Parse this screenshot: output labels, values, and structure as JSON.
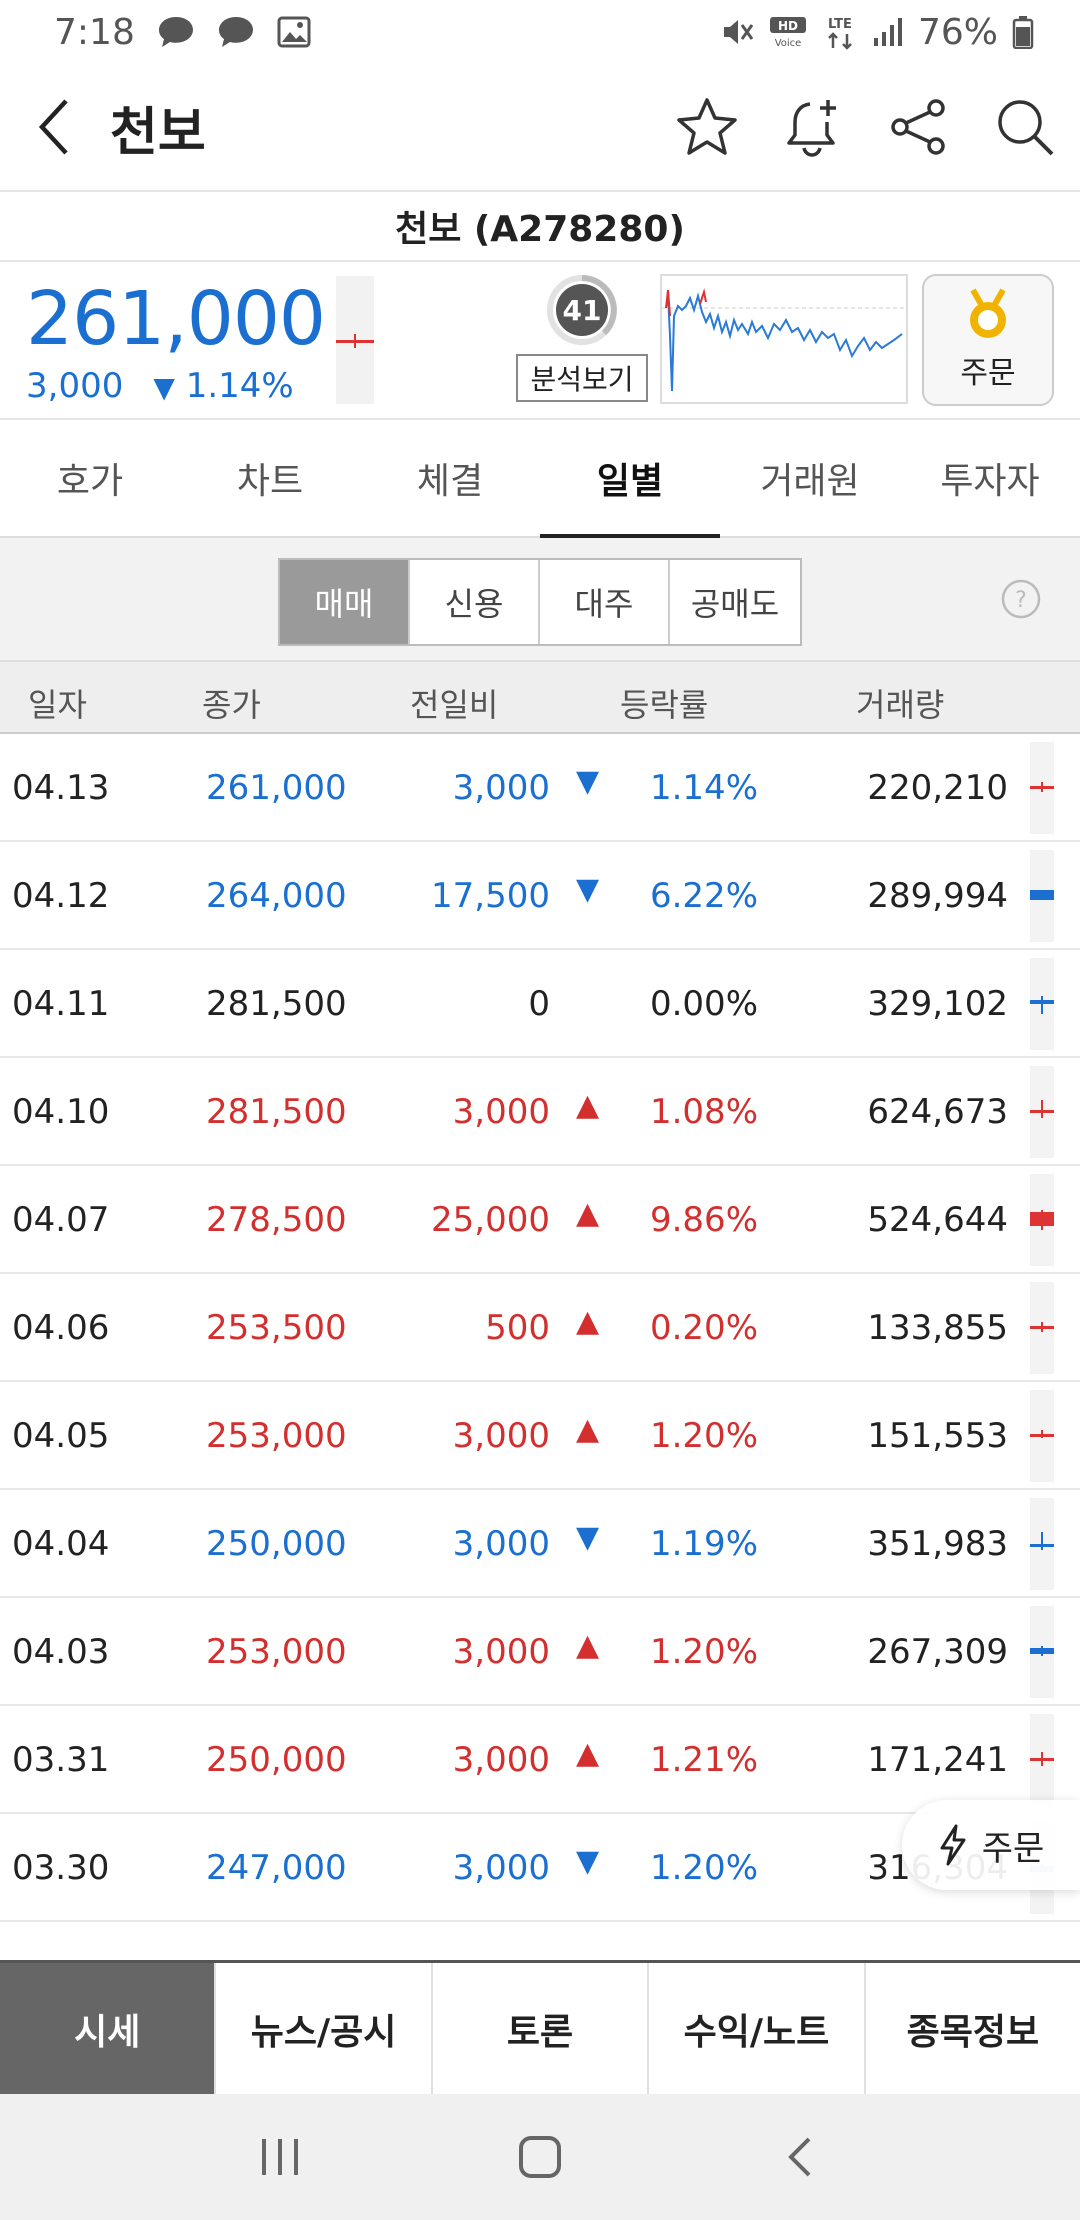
{
  "status_bar": {
    "time": "7:18",
    "battery": "76%"
  },
  "header": {
    "title": "천보"
  },
  "stock": {
    "name_code": "천보 (A278280)",
    "price": "261,000",
    "change": "3,000",
    "change_rate": "1.14%",
    "change_arrow": "▼",
    "score": "41",
    "analysis_label": "분석보기",
    "order_label": "주문",
    "colors": {
      "up": "#d32f2f",
      "down": "#1a6fd0"
    }
  },
  "tabs": [
    {
      "label": "호가"
    },
    {
      "label": "차트"
    },
    {
      "label": "체결"
    },
    {
      "label": "일별",
      "active": true
    },
    {
      "label": "거래원"
    },
    {
      "label": "투자자"
    }
  ],
  "filters": [
    {
      "label": "매매",
      "active": true
    },
    {
      "label": "신용"
    },
    {
      "label": "대주"
    },
    {
      "label": "공매도"
    }
  ],
  "table": {
    "headers": {
      "date": "일자",
      "close": "종가",
      "diff": "전일비",
      "rate": "등락률",
      "volume": "거래량"
    },
    "rows": [
      {
        "date": "04.13",
        "close": "261,000",
        "diff": "3,000",
        "arrow": "▼",
        "rate": "1.14%",
        "volume": "220,210",
        "dir": "down"
      },
      {
        "date": "04.12",
        "close": "264,000",
        "diff": "17,500",
        "arrow": "▼",
        "rate": "6.22%",
        "volume": "289,994",
        "dir": "down"
      },
      {
        "date": "04.11",
        "close": "281,500",
        "diff": "0",
        "arrow": "",
        "rate": "0.00%",
        "volume": "329,102",
        "dir": "flat"
      },
      {
        "date": "04.10",
        "close": "281,500",
        "diff": "3,000",
        "arrow": "▲",
        "rate": "1.08%",
        "volume": "624,673",
        "dir": "up"
      },
      {
        "date": "04.07",
        "close": "278,500",
        "diff": "25,000",
        "arrow": "▲",
        "rate": "9.86%",
        "volume": "524,644",
        "dir": "up"
      },
      {
        "date": "04.06",
        "close": "253,500",
        "diff": "500",
        "arrow": "▲",
        "rate": "0.20%",
        "volume": "133,855",
        "dir": "up"
      },
      {
        "date": "04.05",
        "close": "253,000",
        "diff": "3,000",
        "arrow": "▲",
        "rate": "1.20%",
        "volume": "151,553",
        "dir": "up"
      },
      {
        "date": "04.04",
        "close": "250,000",
        "diff": "3,000",
        "arrow": "▼",
        "rate": "1.19%",
        "volume": "351,983",
        "dir": "down"
      },
      {
        "date": "04.03",
        "close": "253,000",
        "diff": "3,000",
        "arrow": "▲",
        "rate": "1.20%",
        "volume": "267,309",
        "dir": "up"
      },
      {
        "date": "03.31",
        "close": "250,000",
        "diff": "3,000",
        "arrow": "▲",
        "rate": "1.21%",
        "volume": "171,241",
        "dir": "up"
      },
      {
        "date": "03.30",
        "close": "247,000",
        "diff": "3,000",
        "arrow": "▼",
        "rate": "1.20%",
        "volume": "316,304",
        "dir": "down"
      }
    ]
  },
  "floating_order": {
    "label": "주문"
  },
  "bottom_nav": [
    {
      "label": "시세",
      "active": true
    },
    {
      "label": "뉴스/공시"
    },
    {
      "label": "토론"
    },
    {
      "label": "수익/노트"
    },
    {
      "label": "종목정보"
    }
  ]
}
